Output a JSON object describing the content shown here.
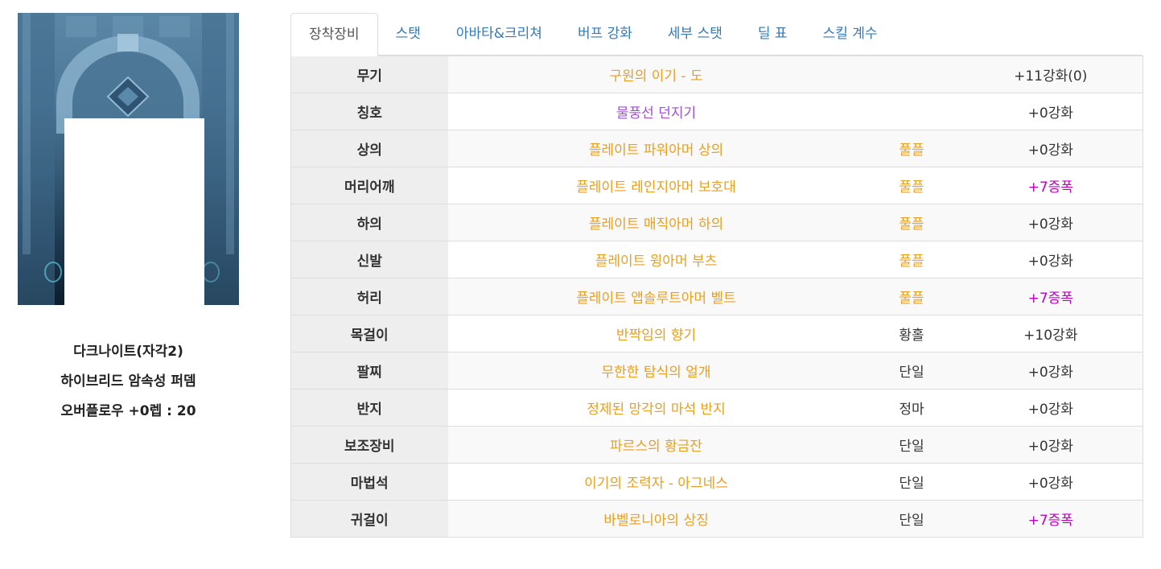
{
  "character": {
    "name": "다크나이트(자각2)",
    "build": "하이브리드 암속성 퍼뎀",
    "overflow": "오버플로우 +0렙 : 20"
  },
  "tabs": [
    {
      "label": "장착장비",
      "active": true
    },
    {
      "label": "스탯",
      "active": false
    },
    {
      "label": "아바타&크리쳐",
      "active": false
    },
    {
      "label": "버프 강화",
      "active": false
    },
    {
      "label": "세부 스탯",
      "active": false
    },
    {
      "label": "딜 표",
      "active": false
    },
    {
      "label": "스킬 계수",
      "active": false
    }
  ],
  "colors": {
    "epic": "#e8a020",
    "unique": "#a050d0",
    "type_set": "#e8a020",
    "type_normal": "#333333",
    "amplify": "#c000c0",
    "enhance": "#333333"
  },
  "equipment": [
    {
      "slot": "무기",
      "name": "구원의 이기 - 도",
      "rarity": "epic",
      "type": "",
      "type_kind": "normal",
      "enhance": "+11강화(0)",
      "enhance_kind": "enhance"
    },
    {
      "slot": "칭호",
      "name": "물풍선 던지기",
      "rarity": "unique",
      "type": "",
      "type_kind": "normal",
      "enhance": "+0강화",
      "enhance_kind": "enhance"
    },
    {
      "slot": "상의",
      "name": "플레이트 파워아머 상의",
      "rarity": "epic",
      "type": "풀플",
      "type_kind": "set",
      "enhance": "+0강화",
      "enhance_kind": "enhance"
    },
    {
      "slot": "머리어깨",
      "name": "플레이트 레인지아머 보호대",
      "rarity": "epic",
      "type": "풀플",
      "type_kind": "set",
      "enhance": "+7증폭",
      "enhance_kind": "amplify"
    },
    {
      "slot": "하의",
      "name": "플레이트 매직아머 하의",
      "rarity": "epic",
      "type": "풀플",
      "type_kind": "set",
      "enhance": "+0강화",
      "enhance_kind": "enhance"
    },
    {
      "slot": "신발",
      "name": "플레이트 윙아머 부츠",
      "rarity": "epic",
      "type": "풀플",
      "type_kind": "set",
      "enhance": "+0강화",
      "enhance_kind": "enhance"
    },
    {
      "slot": "허리",
      "name": "플레이트 앱솔루트아머 벨트",
      "rarity": "epic",
      "type": "풀플",
      "type_kind": "set",
      "enhance": "+7증폭",
      "enhance_kind": "amplify"
    },
    {
      "slot": "목걸이",
      "name": "반짝임의 향기",
      "rarity": "epic",
      "type": "황홀",
      "type_kind": "normal",
      "enhance": "+10강화",
      "enhance_kind": "enhance"
    },
    {
      "slot": "팔찌",
      "name": "무한한 탐식의 얼개",
      "rarity": "epic",
      "type": "단일",
      "type_kind": "normal",
      "enhance": "+0강화",
      "enhance_kind": "enhance"
    },
    {
      "slot": "반지",
      "name": "정제된 망각의 마석 반지",
      "rarity": "epic",
      "type": "정마",
      "type_kind": "normal",
      "enhance": "+0강화",
      "enhance_kind": "enhance"
    },
    {
      "slot": "보조장비",
      "name": "파르스의 황금잔",
      "rarity": "epic",
      "type": "단일",
      "type_kind": "normal",
      "enhance": "+0강화",
      "enhance_kind": "enhance"
    },
    {
      "slot": "마법석",
      "name": "이기의 조력자 - 아그네스",
      "rarity": "epic",
      "type": "단일",
      "type_kind": "normal",
      "enhance": "+0강화",
      "enhance_kind": "enhance"
    },
    {
      "slot": "귀걸이",
      "name": "바벨로니아의 상징",
      "rarity": "epic",
      "type": "단일",
      "type_kind": "normal",
      "enhance": "+7증폭",
      "enhance_kind": "amplify"
    }
  ]
}
